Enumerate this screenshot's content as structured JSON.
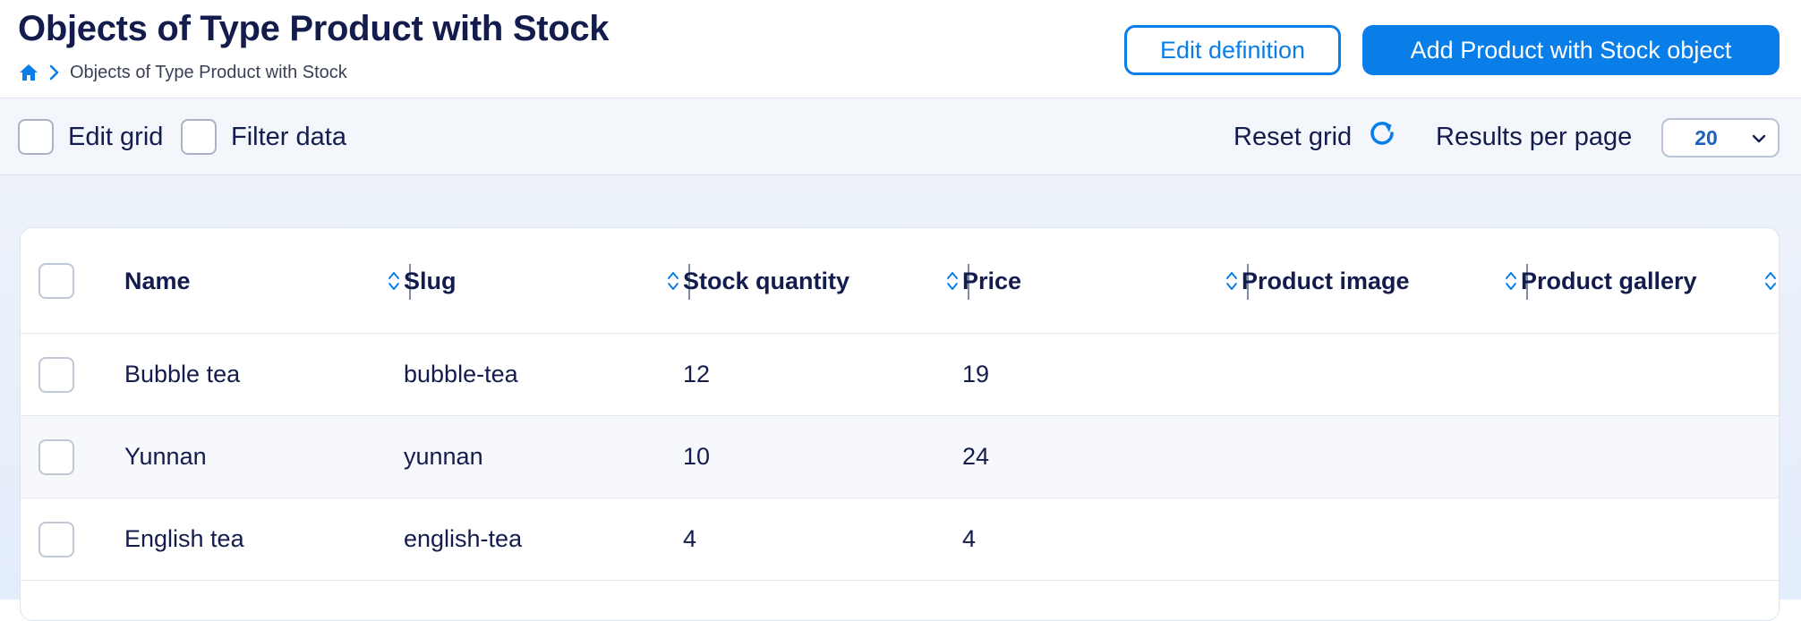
{
  "header": {
    "title": "Objects of Type Product with Stock",
    "breadcrumb": {
      "home_icon": "home-icon",
      "separator_icon": "chevron-right-icon",
      "current": "Objects of Type Product with Stock"
    },
    "edit_definition_label": "Edit definition",
    "add_object_label": "Add Product with Stock object"
  },
  "toolbar": {
    "edit_grid_label": "Edit grid",
    "filter_data_label": "Filter data",
    "reset_grid_label": "Reset grid",
    "reset_icon": "refresh-icon",
    "results_per_page_label": "Results per page",
    "results_per_page_value": "20"
  },
  "table": {
    "columns": [
      "Name",
      "Slug",
      "Stock quantity",
      "Price",
      "Product image",
      "Product gallery"
    ],
    "rows": [
      {
        "name": "Bubble tea",
        "slug": "bubble-tea",
        "stock": "12",
        "price": "19",
        "image": "",
        "gallery": ""
      },
      {
        "name": "Yunnan",
        "slug": "yunnan",
        "stock": "10",
        "price": "24",
        "image": "",
        "gallery": ""
      },
      {
        "name": "English tea",
        "slug": "english-tea",
        "stock": "4",
        "price": "4",
        "image": "",
        "gallery": ""
      }
    ]
  },
  "colors": {
    "primary": "#0a7ee8",
    "title": "#131c4d",
    "toolbar_bg": "#f3f6fb"
  }
}
